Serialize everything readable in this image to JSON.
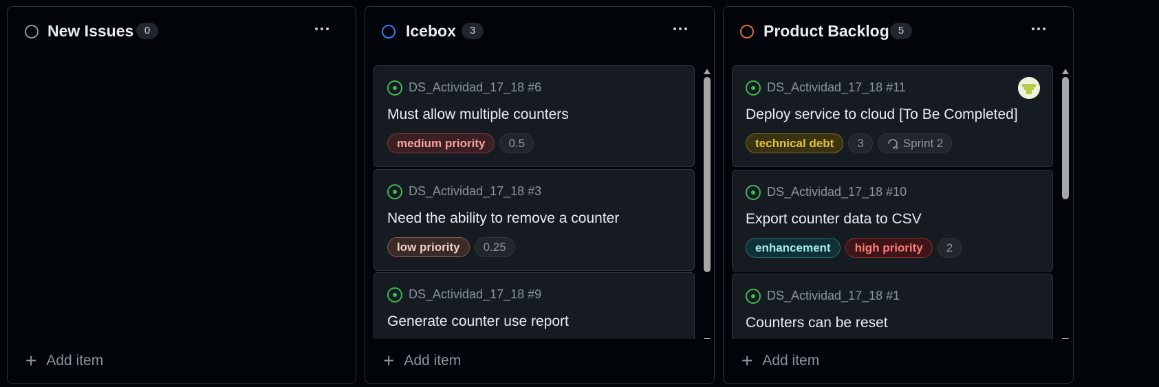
{
  "board": {
    "columns": [
      {
        "title": "New Issues",
        "count": "0",
        "status_color": "#8b949e",
        "add_label": "Add item",
        "cards": []
      },
      {
        "title": "Icebox",
        "count": "3",
        "status_color": "#2f81f7",
        "add_label": "Add item",
        "cards": [
          {
            "ref": "DS_Actividad_17_18 #6",
            "title": "Must allow multiple counters",
            "labels": [
              "medium priority"
            ],
            "estimate": "0.5"
          },
          {
            "ref": "DS_Actividad_17_18 #3",
            "title": "Need the ability to remove a counter",
            "labels": [
              "low priority"
            ],
            "estimate": "0.25"
          },
          {
            "ref": "DS_Actividad_17_18 #9",
            "title": "Generate counter use report"
          }
        ]
      },
      {
        "title": "Product Backlog",
        "count": "5",
        "status_color": "#db6d28",
        "add_label": "Add item",
        "cards": [
          {
            "ref": "DS_Actividad_17_18 #11",
            "title": "Deploy service to cloud [To Be Completed]",
            "labels": [
              "technical debt"
            ],
            "estimate": "3",
            "iteration": "Sprint 2",
            "avatar": true
          },
          {
            "ref": "DS_Actividad_17_18 #10",
            "title": "Export counter data to CSV",
            "labels": [
              "enhancement",
              "high priority"
            ],
            "estimate": "2"
          },
          {
            "ref": "DS_Actividad_17_18 #1",
            "title": "Counters can be reset"
          }
        ]
      }
    ]
  },
  "label_colors": {
    "medium priority": {
      "bg": "#3b1f22",
      "border": "#7a3b40",
      "text": "#f4a3a3"
    },
    "low priority": {
      "bg": "#3a2a28",
      "border": "#7d5c57",
      "text": "#f3cfc8"
    },
    "technical debt": {
      "bg": "#3a3212",
      "border": "#7a6a1f",
      "text": "#e3c341"
    },
    "enhancement": {
      "bg": "#0f3034",
      "border": "#2a6b70",
      "text": "#a2eeef"
    },
    "high priority": {
      "bg": "#3d1417",
      "border": "#8a2c32",
      "text": "#ff7b7b"
    }
  }
}
